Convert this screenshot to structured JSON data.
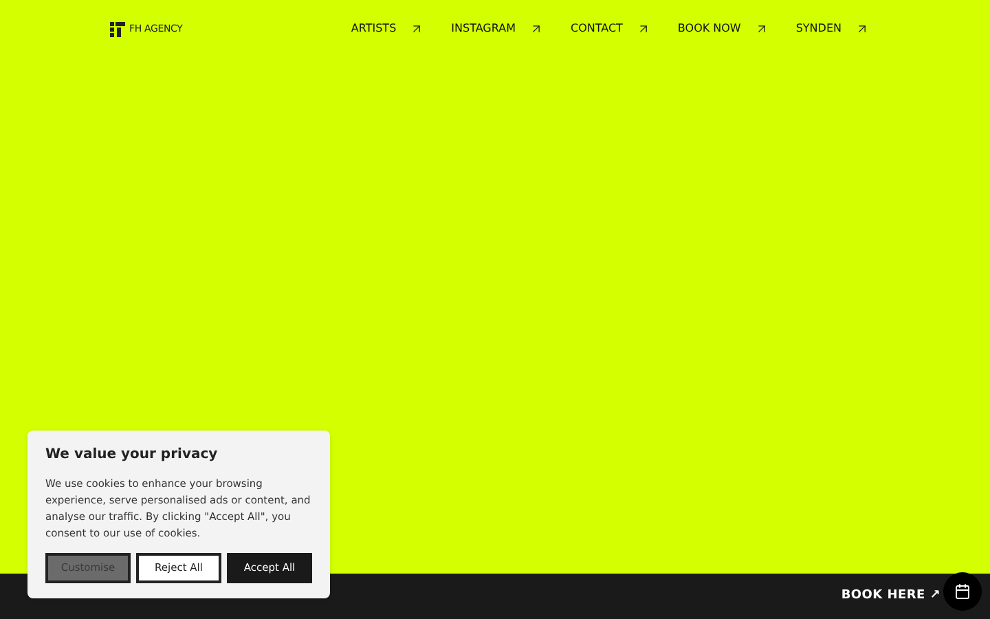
{
  "logo": {
    "text": "FH AGENCY"
  },
  "nav": [
    {
      "label": "ARTISTS"
    },
    {
      "label": "INSTAGRAM"
    },
    {
      "label": "CONTACT"
    },
    {
      "label": "BOOK NOW"
    },
    {
      "label": "SYNDEN"
    }
  ],
  "cookie_dialog": {
    "title": "We value your privacy",
    "body": "We use cookies to enhance your browsing experience, serve personalised ads or content, and analyse our traffic. By clicking \"Accept All\", you consent to our use of cookies.",
    "buttons": [
      {
        "label": "Customise",
        "kind": "grey"
      },
      {
        "label": "Reject All",
        "kind": "outline"
      },
      {
        "label": "Accept All",
        "kind": "dark"
      }
    ]
  },
  "footer": {
    "book_label": "BOOK HERE ↗"
  }
}
